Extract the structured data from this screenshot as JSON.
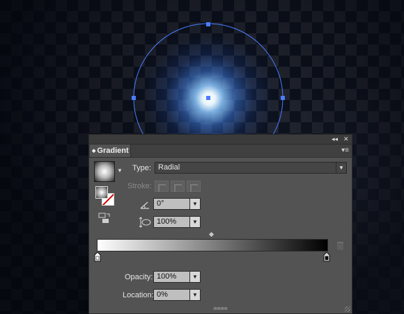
{
  "panel": {
    "title": "Gradient",
    "type_label": "Type:",
    "type_value": "Radial",
    "stroke_label": "Stroke:",
    "angle_value": "0°",
    "aspect_value": "100%",
    "opacity_label": "Opacity:",
    "opacity_value": "100%",
    "location_label": "Location:",
    "location_value": "0%",
    "collapse_glyph": "◂◂",
    "close_glyph": "✕",
    "menu_glyph": "▾≡"
  },
  "gradient": {
    "type": "radial",
    "stops": [
      {
        "color": "#ffffff",
        "location": 0
      },
      {
        "color": "#000000",
        "location": 100
      }
    ],
    "selected_stop": 0
  },
  "canvas": {
    "object_shape": "circle",
    "selection_color": "#4a7cff",
    "glow_color": "#8cc8ff"
  },
  "colors": {
    "panel_bg": "#535353",
    "tab_bar": "#404040",
    "field_bg": "#bfbfbf"
  }
}
